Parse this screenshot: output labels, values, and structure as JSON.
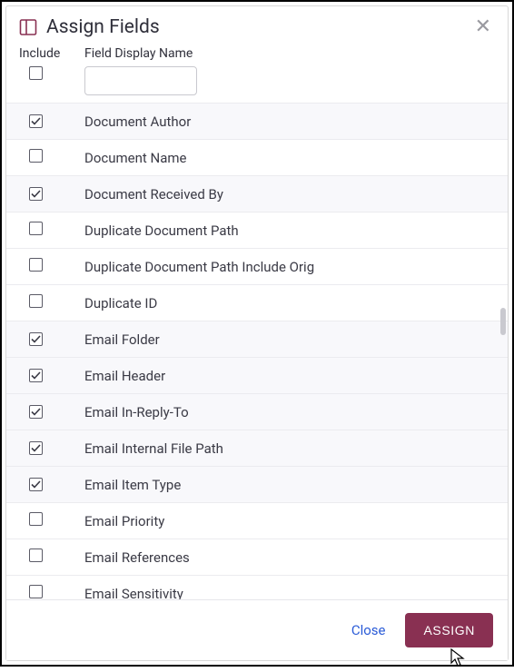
{
  "dialog": {
    "title": "Assign Fields"
  },
  "columns": {
    "include": "Include",
    "field_name": "Field Display Name"
  },
  "filter": {
    "value": ""
  },
  "fields": [
    {
      "label": "Document Author",
      "checked": true
    },
    {
      "label": "Document Name",
      "checked": false
    },
    {
      "label": "Document Received By",
      "checked": true
    },
    {
      "label": "Duplicate Document Path",
      "checked": false
    },
    {
      "label": "Duplicate Document Path Include Orig",
      "checked": false
    },
    {
      "label": "Duplicate ID",
      "checked": false
    },
    {
      "label": "Email Folder",
      "checked": true
    },
    {
      "label": "Email Header",
      "checked": true
    },
    {
      "label": "Email In-Reply-To",
      "checked": true
    },
    {
      "label": "Email Internal File Path",
      "checked": true
    },
    {
      "label": "Email Item Type",
      "checked": true
    },
    {
      "label": "Email Priority",
      "checked": false
    },
    {
      "label": "Email References",
      "checked": false
    },
    {
      "label": "Email Sensitivity",
      "checked": false
    }
  ],
  "footer": {
    "close": "Close",
    "assign": "ASSIGN"
  }
}
